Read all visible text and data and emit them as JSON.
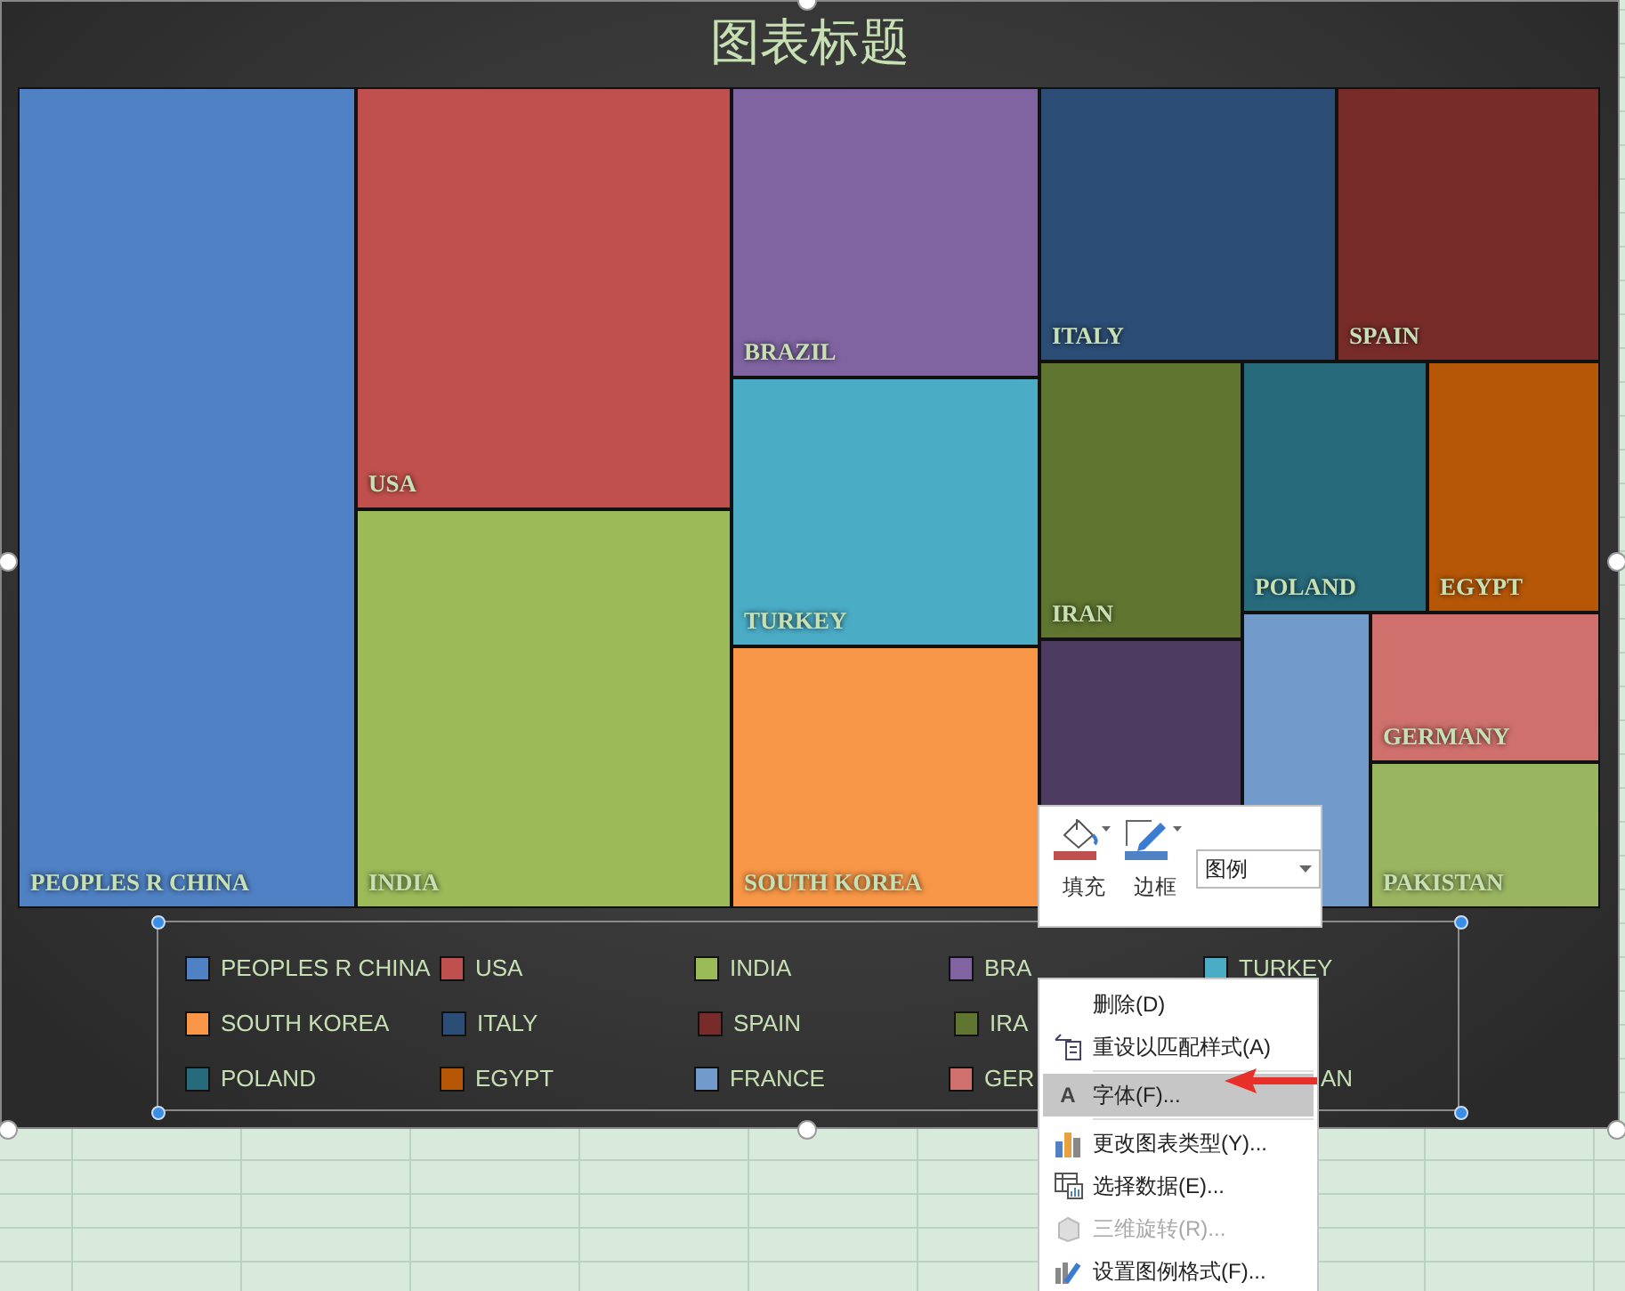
{
  "chart": {
    "title": "图表标题",
    "tiles": [
      {
        "label": "PEOPLES R CHINA",
        "color": "#4f81c4"
      },
      {
        "label": "USA",
        "color": "#c0504d"
      },
      {
        "label": "INDIA",
        "color": "#9bbb59"
      },
      {
        "label": "BRAZIL",
        "color": "#8064a2"
      },
      {
        "label": "TURKEY",
        "color": "#4bacc6"
      },
      {
        "label": "SOUTH KOREA",
        "color": "#f79646"
      },
      {
        "label": "ITALY",
        "color": "#2c4d75"
      },
      {
        "label": "SPAIN",
        "color": "#772c2a"
      },
      {
        "label": "IRAN",
        "color": "#5f7530"
      },
      {
        "label": "POLAND",
        "color": "#276a7c"
      },
      {
        "label": "EGYPT",
        "color": "#b65708"
      },
      {
        "color": "#4d3b62"
      },
      {
        "color": "#729aca"
      },
      {
        "label": "GERMANY",
        "color": "#d0706d"
      },
      {
        "label": "PAKISTAN",
        "color": "#9ab560"
      }
    ],
    "legend": {
      "rows": [
        [
          {
            "label": "PEOPLES R CHINA",
            "color": "#4f81c4"
          },
          {
            "label": "USA",
            "color": "#c0504d"
          },
          {
            "label": "INDIA",
            "color": "#9bbb59"
          },
          {
            "label": "BRA",
            "color": "#8064a2"
          },
          {
            "label": "TURKEY",
            "color": "#4bacc6"
          }
        ],
        [
          {
            "label": "SOUTH KOREA",
            "color": "#f79646"
          },
          {
            "label": "ITALY",
            "color": "#2c4d75"
          },
          {
            "label": "SPAIN",
            "color": "#772c2a"
          },
          {
            "label": "IRA",
            "color": "#5f7530"
          }
        ],
        [
          {
            "label": "POLAND",
            "color": "#276a7c"
          },
          {
            "label": "EGYPT",
            "color": "#b65708"
          },
          {
            "label": "FRANCE",
            "color": "#729aca"
          },
          {
            "label": "GER",
            "color": "#d0706d"
          },
          {
            "label": "AN"
          }
        ]
      ]
    }
  },
  "mini_toolbar": {
    "fill_label": "填充",
    "border_label": "边框",
    "selector_value": "图例"
  },
  "context_menu": [
    {
      "label": "删除(D)",
      "selected": false,
      "disabled": false
    },
    {
      "label": "重设以匹配样式(A)",
      "selected": false,
      "disabled": false,
      "separator_after": true
    },
    {
      "icon_text": "A",
      "label": "字体(F)...",
      "selected": true,
      "disabled": false,
      "separator_after": true
    },
    {
      "label": "更改图表类型(Y)...",
      "selected": false,
      "disabled": false
    },
    {
      "label": "选择数据(E)...",
      "selected": false,
      "disabled": false
    },
    {
      "label": "三维旋转(R)...",
      "selected": false,
      "disabled": true
    },
    {
      "label": "设置图例格式(F)...",
      "selected": false,
      "disabled": false
    }
  ]
}
